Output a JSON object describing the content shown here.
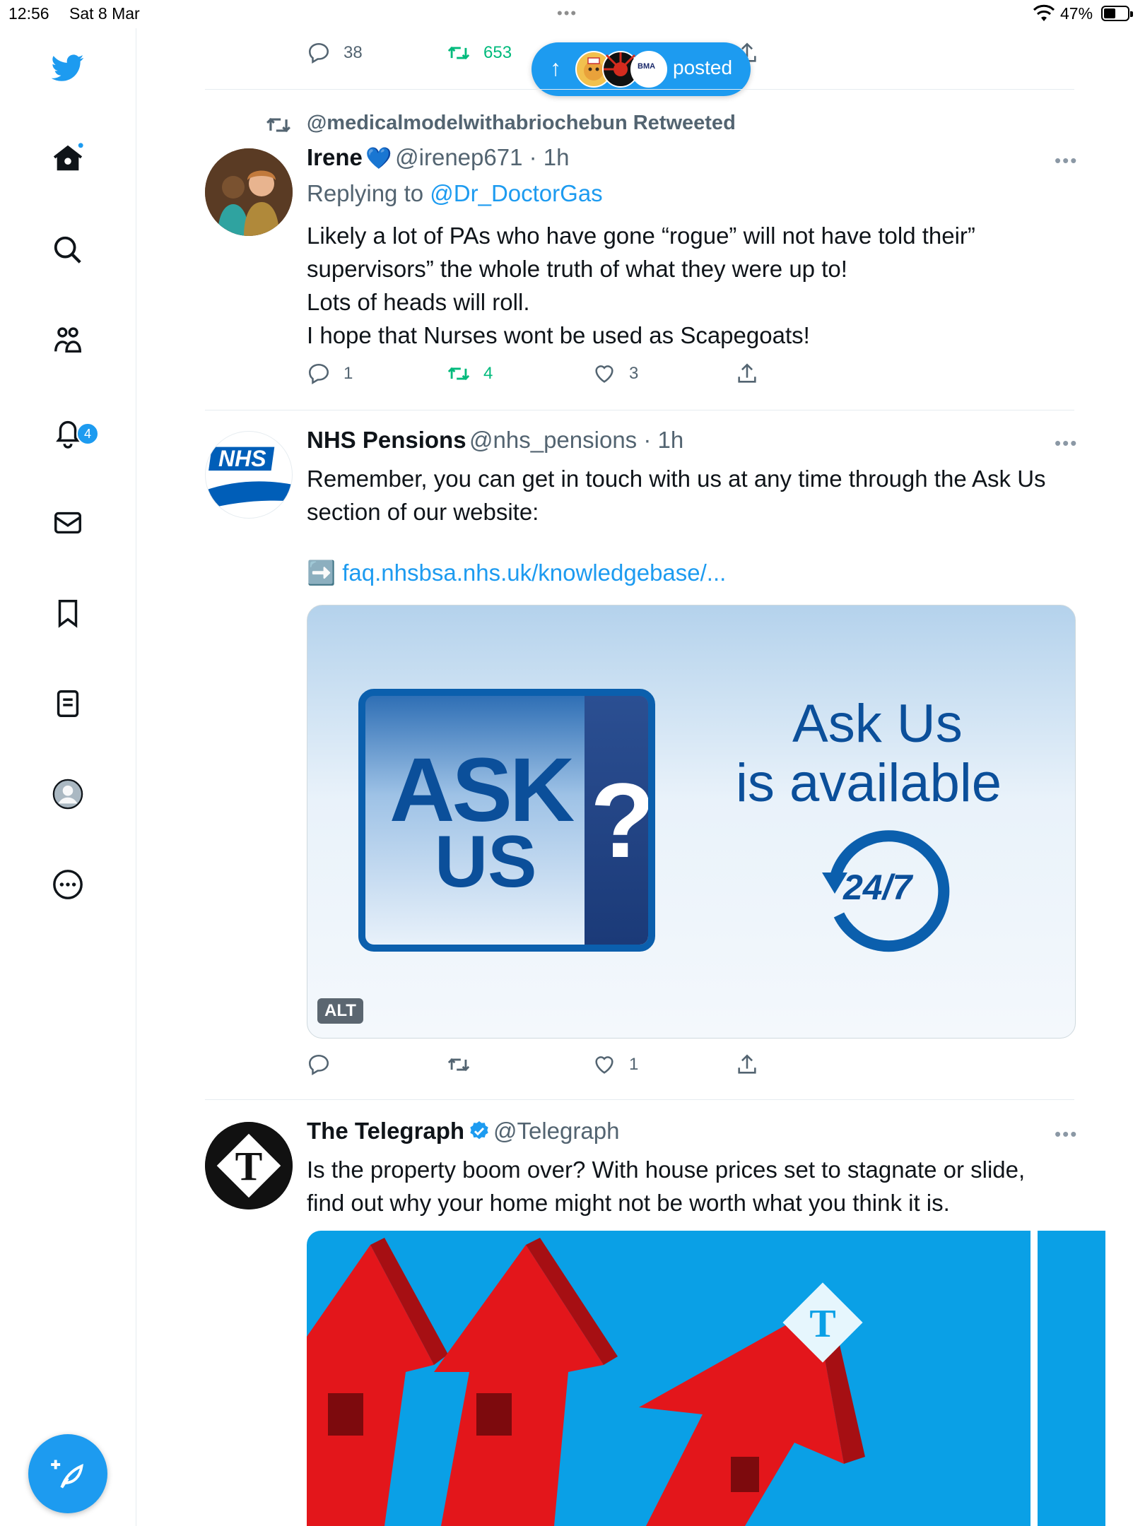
{
  "status_bar": {
    "time": "12:56",
    "date": "Sat 8 Mar",
    "dots": "•••",
    "battery": "47%"
  },
  "nav": {
    "notifications_badge": "4"
  },
  "top_tweet": {
    "replies": "38",
    "retweets": "653"
  },
  "posted_pill": {
    "arrow": "↑",
    "label": "posted",
    "avatar_text": "BMA"
  },
  "tweet1": {
    "retweeted_by": "@medicalmodelwithabriochebun Retweeted",
    "name": "Irene",
    "emoji": "💙",
    "handle": "@irenep671 · 1h",
    "replying_prefix": "Replying to",
    "replying_to": "@Dr_DoctorGas",
    "lines": [
      "Likely a lot of PAs  who have gone “rogue” will not have told their”",
      "supervisors” the whole truth of what they were up to!",
      "Lots of heads will roll.",
      "I hope that Nurses wont be used as Scapegoats!"
    ],
    "replies": "1",
    "retweets": "4",
    "likes": "3"
  },
  "tweet2": {
    "avatar_text": "NHS",
    "name": "NHS Pensions",
    "handle": "@nhs_pensions · 1h",
    "lines": [
      "Remember, you can get in touch with us at any time through the Ask Us",
      "section of our website:"
    ],
    "link_emoji": "➡️",
    "link": "faq.nhsbsa.nhs.uk/knowledgebase/...",
    "image": {
      "ask": "ASK",
      "us": "US",
      "question": "?",
      "heading1": "Ask Us",
      "heading2": "is available",
      "clock": "24/7",
      "alt": "ALT"
    },
    "likes": "1"
  },
  "tweet3": {
    "name": "The Telegraph",
    "handle": "@Telegraph",
    "lines": [
      "Is the property boom over? With house prices set to stagnate or slide,",
      "find out why your home might not be worth what you think it is."
    ]
  },
  "colors": {
    "twitter_blue": "#1d9bf0",
    "retweet_green": "#00ba7c",
    "nhs_blue": "#005eb8",
    "telegraph_bg": "#0aa0e6",
    "house_red": "#e3161b"
  }
}
